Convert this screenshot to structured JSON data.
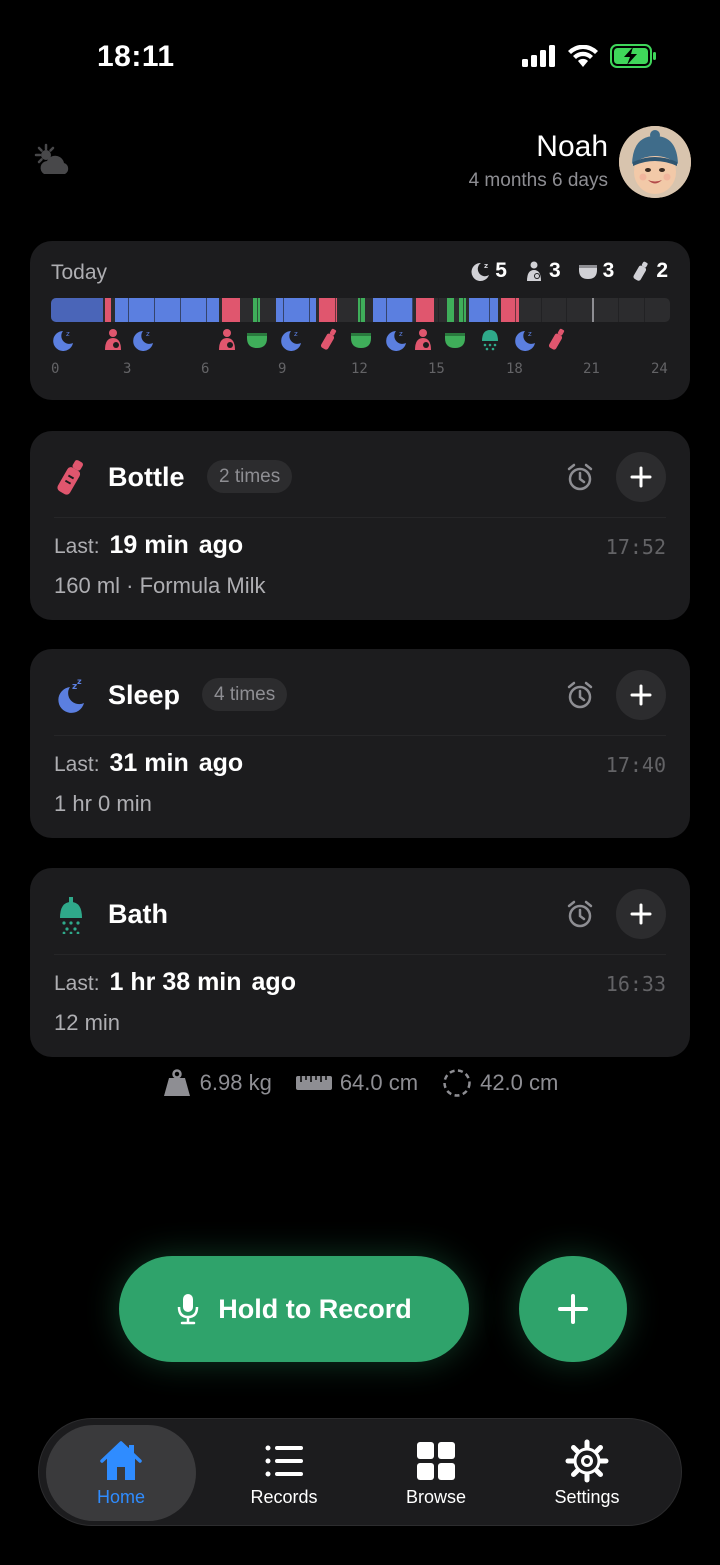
{
  "status": {
    "time": "18:11"
  },
  "header": {
    "baby_name": "Noah",
    "baby_age": "4 months 6 days"
  },
  "today": {
    "title": "Today",
    "stats": {
      "sleep": "5",
      "feeding": "3",
      "diaper": "3",
      "bottle": "2"
    },
    "hour_labels": [
      "0",
      "3",
      "6",
      "9",
      "12",
      "15",
      "18",
      "21",
      "24"
    ]
  },
  "cards": [
    {
      "title": "Bottle",
      "badge": "2 times",
      "last_label": "Last:",
      "last_value": "19 min",
      "last_ago": "ago",
      "time": "17:52",
      "detail": "160 ml · Formula Milk"
    },
    {
      "title": "Sleep",
      "badge": "4 times",
      "last_label": "Last:",
      "last_value": "31 min",
      "last_ago": "ago",
      "time": "17:40",
      "detail": "1 hr 0 min"
    },
    {
      "title": "Bath",
      "badge": "",
      "last_label": "Last:",
      "last_value": "1 hr 38 min",
      "last_ago": "ago",
      "time": "16:33",
      "detail": "12 min"
    }
  ],
  "measurements": {
    "weight": "6.98 kg",
    "height": "64.0 cm",
    "head": "42.0 cm"
  },
  "actions": {
    "record_label": "Hold to Record"
  },
  "tabs": [
    {
      "label": "Home",
      "icon": "home-icon",
      "active": true
    },
    {
      "label": "Records",
      "icon": "list-icon",
      "active": false
    },
    {
      "label": "Browse",
      "icon": "grid-icon",
      "active": false
    },
    {
      "label": "Settings",
      "icon": "gear-icon",
      "active": false
    }
  ],
  "colors": {
    "sleep": "#5b7fe0",
    "feeding": "#e0566e",
    "diaper": "#3fae5a",
    "bath": "#2fa98a",
    "accent": "#2fa36b",
    "active_tab": "#2f8cff"
  }
}
